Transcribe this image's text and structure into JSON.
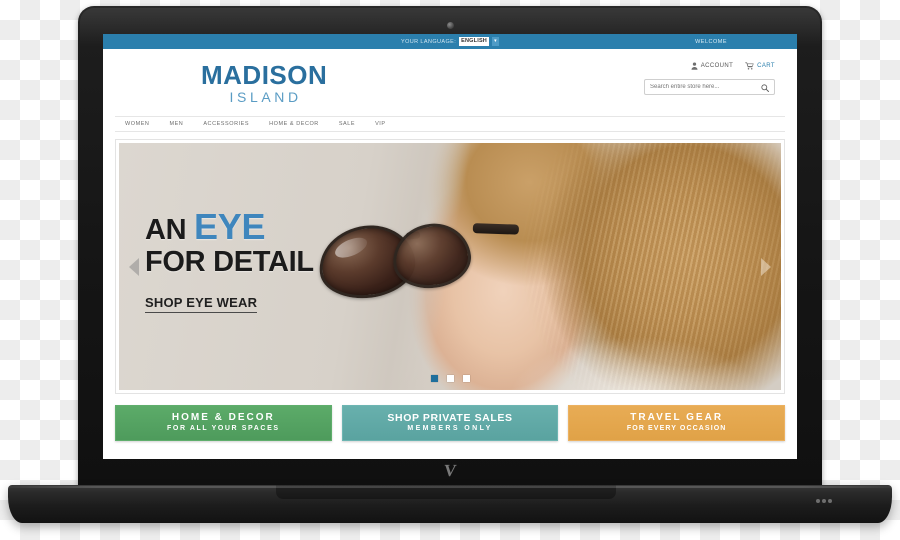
{
  "device": {
    "type": "laptop-mockup",
    "brand_mark": "V",
    "bezel_color": "#151515",
    "base_color": "#1c1c1c"
  },
  "site": {
    "topbar": {
      "language_label": "YOUR LANGUAGE:",
      "language_value": "ENGLISH",
      "welcome": "WELCOME",
      "bg_color": "#2b7fad"
    },
    "logo": {
      "line1": "MADISON",
      "line2": "ISLAND",
      "color_primary": "#2a6f9e",
      "color_secondary": "#5a9cc4"
    },
    "header_links": [
      {
        "label": "ACCOUNT",
        "icon": "person-icon"
      },
      {
        "label": "CART",
        "icon": "cart-icon"
      }
    ],
    "search": {
      "placeholder": "Search entire store here...",
      "value": "",
      "icon": "search-icon"
    },
    "nav": [
      {
        "label": "WOMEN"
      },
      {
        "label": "MEN"
      },
      {
        "label": "ACCESSORIES"
      },
      {
        "label": "HOME & DECOR"
      },
      {
        "label": "SALE"
      },
      {
        "label": "VIP"
      }
    ],
    "hero": {
      "headline_1_pre": "AN ",
      "headline_1_accent": "EYE",
      "headline_2": "FOR DETAIL",
      "cta": "SHOP EYE WEAR",
      "accent_color": "#3f86bd",
      "prev_icon": "chevron-left-icon",
      "next_icon": "chevron-right-icon",
      "slides": 3,
      "active_slide": 1
    },
    "promos": [
      {
        "title": "HOME & DECOR",
        "subtitle": "FOR ALL YOUR SPACES",
        "color": "#5cab69"
      },
      {
        "title": "SHOP PRIVATE SALES",
        "subtitle": "MEMBERS ONLY",
        "color": "#68b0ad"
      },
      {
        "title": "TRAVEL GEAR",
        "subtitle": "FOR EVERY OCCASION",
        "color": "#e8ac55"
      }
    ]
  }
}
